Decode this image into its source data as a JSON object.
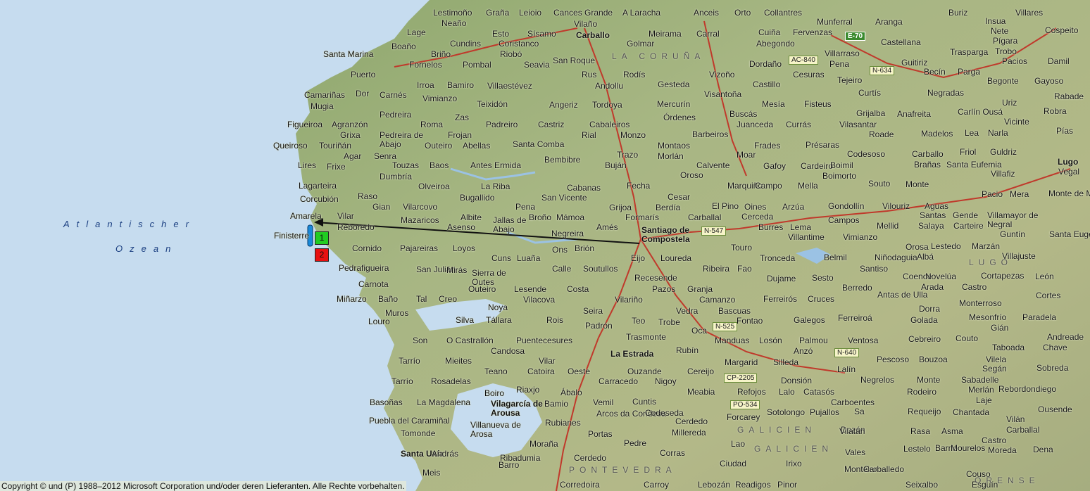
{
  "map": {
    "sea_labels": [
      "Atlantischer",
      "Ozean"
    ],
    "region_labels": [
      "LA CORUÑA",
      "GALICIEN",
      "GALICIEN",
      "PONTEVEDRA",
      "LUGO",
      "ORENSE"
    ],
    "place_labels": [
      "Lestimoño",
      "Neaño",
      "Graña",
      "Leioio",
      "Cances Grande",
      "A Laracha",
      "Anceis",
      "Orto",
      "Collantres",
      "Munferral",
      "Buriz",
      "Insua",
      "Villares",
      "Lage",
      "Vilaño",
      "Carballo",
      "Cuiña",
      "Fervenzas",
      "Aranga",
      "Nete",
      "Cospeito",
      "Boaño",
      "Cundins",
      "Esto",
      "Sísamo",
      "Meirama",
      "Carral",
      "Abegondo",
      "Castellana",
      "Trasparga",
      "Pígara",
      "Trobo",
      "Santa Marina",
      "Briño",
      "Coristanco",
      "Golmar",
      "Villarraso",
      "Pacios",
      "Damil",
      "Fornelos",
      "Pombal",
      "Riobó",
      "Seavia",
      "San Roque",
      "Dordaño",
      "Pena",
      "Guitiriz",
      "Puerto",
      "Rus",
      "Rodís",
      "Vizoño",
      "Cesuras",
      "Becín",
      "Parga",
      "Camariñas",
      "Dor",
      "Irroa",
      "Bamiro",
      "Villaestévez",
      "Andollu",
      "Gesteda",
      "Castillo",
      "Tejeiro",
      "Begonte",
      "Gayoso",
      "Mugia",
      "Carnés",
      "Vimianzo",
      "Visantoña",
      "Curtís",
      "Negradas",
      "Rabade",
      "Pedreira",
      "Teixidón",
      "Angeriz",
      "Tordoya",
      "Mercurín",
      "Mesía",
      "Fisteus",
      "Uriz",
      "Robra",
      "Figueiroa",
      "Agranzón",
      "Zas",
      "Órdenes",
      "Buscás",
      "Grijalba",
      "Anafreita",
      "Carlín Ousá",
      "Grixa",
      "Pedreira de Abajo",
      "Roma",
      "Padreiro",
      "Castriz",
      "Cabaleiros",
      "Juanceda",
      "Currás",
      "Vilasantar",
      "Vicinte",
      "Queiroso",
      "Touriñán",
      "Frojan",
      "Rial",
      "Monzo",
      "Barbeiros",
      "Roade",
      "Madelos",
      "Lea",
      "Narla",
      "Pías",
      "Agar",
      "Outeiro",
      "Abellas",
      "Santa Comba",
      "Montaos",
      "Frades",
      "Présaras",
      "Codesoso",
      "Senra",
      "Trazo",
      "Morlán",
      "Carballo",
      "Friol",
      "Guldriz",
      "Lires",
      "Frixe",
      "Touzas",
      "Baos",
      "Antes Ermida",
      "Bembibre",
      "Buján",
      "Calvente",
      "Moar",
      "Gafoy",
      "Cardeiro",
      "Boimil",
      "Brañas",
      "Santa Eufemia",
      "Villafiz",
      "Lugo",
      "Dumbría",
      "Boimorto",
      "Vegal",
      "Lagarteira",
      "Olveiroa",
      "La Riba",
      "Cabanas",
      "Fecha",
      "Oroso",
      "Marquiño",
      "Campo",
      "Mella",
      "Souto",
      "Monte",
      "Corcubión",
      "Raso",
      "Bugallido",
      "San Vicente",
      "Cesar",
      "Pacio",
      "Mera",
      "Monte de Meda",
      "Amarela",
      "Gian",
      "Vilarcovo",
      "Pena",
      "Grijoa",
      "Berdía",
      "El Pino",
      "Oines",
      "Arzúa",
      "Gondollín",
      "Vilouriz",
      "Aguas",
      "Vilar",
      "Albite",
      "Jallas de Abajo",
      "Broño",
      "Mámoa",
      "Formarís",
      "Carballal",
      "Cerceda",
      "Santas",
      "Gende",
      "Villamayor de Negral",
      "Finisterre",
      "Reboredo",
      "Mazaricos",
      "Asenso",
      "Amés",
      "Santiago de Compostela",
      "Burres",
      "Lema",
      "Campos",
      "Mellid",
      "Salaya",
      "Carteire",
      "Negreira",
      "Villantime",
      "Vimianzo",
      "Guntín",
      "Santa Eugea",
      "Cornido",
      "Pajareiras",
      "Loyos",
      "Ons",
      "Brión",
      "Touro",
      "Orosa",
      "Lestedo",
      "Marzán",
      "Cuns",
      "Luaña",
      "Eijo",
      "Loureda",
      "Tronceda",
      "Belmil",
      "Niñodaguia",
      "Albá",
      "Villajuste",
      "Pedrafigueira",
      "San Julián",
      "Mirás",
      "Sierra de Outes",
      "Calle",
      "Soutullos",
      "Ribeira",
      "Fao",
      "Santiso",
      "Recesende",
      "Dujame",
      "Sesto",
      "Coence",
      "Novelúa",
      "Cortapezas",
      "León",
      "Carnota",
      "Outeiro",
      "Lesende",
      "Costa",
      "Pazos",
      "Granja",
      "Berredo",
      "Arada",
      "Castro",
      "Miñarzo",
      "Baño",
      "Tal",
      "Creo",
      "Vilacova",
      "Vilariño",
      "Camanzo",
      "Ferreirós",
      "Cruces",
      "Antas de Ulla",
      "Cortes",
      "Muros",
      "Noya",
      "Seira",
      "Bascuas",
      "Vedra",
      "Dorra",
      "Monterroso",
      "Louro",
      "Silva",
      "Tállara",
      "Rois",
      "Padrón",
      "Teo",
      "Trobe",
      "Oca",
      "Fontao",
      "Galegos",
      "Ferreiroá",
      "Golada",
      "Mesonfrío",
      "Paradela",
      "Son",
      "O Castrallón",
      "Puentecesures",
      "Trasmonte",
      "Manduas",
      "Losón",
      "Palmou",
      "Ventosa",
      "Cebreiro",
      "Couto",
      "Gián",
      "Andreade",
      "Chave",
      "Candosa",
      "La Estrada",
      "Rubín",
      "Anzó",
      "Taboada",
      "Tarrío",
      "Mieites",
      "Vilar",
      "Margarid",
      "Silleda",
      "Pescoso",
      "Bouzoa",
      "Vilela",
      "Teano",
      "Catoira",
      "Oeste",
      "Ouzande",
      "Cereijo",
      "Lalín",
      "Segán",
      "Sobreda",
      "Tarrío",
      "Rosadelas",
      "Carracedo",
      "Nigoy",
      "Donsión",
      "Negrelos",
      "Monte",
      "Sabadelle",
      "Boiro",
      "Riaxjo",
      "Ábalo",
      "Meabia",
      "Refojos",
      "Lalo",
      "Catasós",
      "Rodeiro",
      "Merlán",
      "Rebordondiego",
      "Basoñas",
      "La Magdalena",
      "Vilagarcía de Arousa",
      "Bamio",
      "Vemil",
      "Cuntis",
      "Carboentes",
      "Laje",
      "Arcos da Condesa",
      "Codeseda",
      "Forcarey",
      "Sotolongo",
      "Pujallos",
      "Sa",
      "Requeijo",
      "Chantada",
      "Ousende",
      "Puebla del Caramiñal",
      "Villanueva de Arosa",
      "Rubianes",
      "Portas",
      "Cerdedo",
      "Dozón",
      "Rasa",
      "Asma",
      "Carballal",
      "Tomonde",
      "Millereda",
      "Lao",
      "Vilatán",
      "Vilán",
      "Santa Uxía",
      "András",
      "Moraña",
      "Pedre",
      "Corras",
      "Vales",
      "Lestelo",
      "Barrio",
      "Mourelos",
      "Castro",
      "Moreda",
      "Dena",
      "Ribadumia",
      "Barro",
      "Cerdedo",
      "Ciudad",
      "Irixo",
      "Monteiro",
      "Carballedo",
      "Couso",
      "Meis",
      "Corredoira",
      "Carroy",
      "Lebozán",
      "Readigos",
      "Pinor",
      "Seixalbo",
      "Esguín"
    ],
    "shields": [
      "E-70",
      "AC-840",
      "N-634",
      "N-547",
      "N-525",
      "N-640",
      "CP-2205",
      "PO-534"
    ],
    "markers": [
      {
        "label": "1",
        "color": "#22cc22"
      },
      {
        "label": "2",
        "color": "#e81010"
      }
    ],
    "colors": {
      "sea": "#c6dcef",
      "land": "#9db17a",
      "route": "#111111"
    }
  },
  "copyright": "Copyright © und (P) 1988–2012 Microsoft Corporation und/oder deren Lieferanten. Alle Rechte vorbehalten."
}
